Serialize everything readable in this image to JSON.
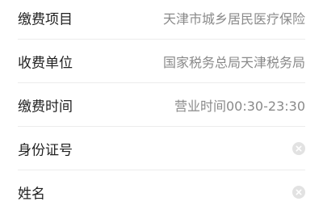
{
  "form": {
    "rows": [
      {
        "label": "缴费项目",
        "value": "天津市城乡居民医疗保险"
      },
      {
        "label": "收费单位",
        "value": "国家税务总局天津税务局"
      },
      {
        "label": "缴费时间",
        "value": "营业时间00:30-23:30"
      },
      {
        "label": "身份证号",
        "value": "",
        "placeholder": "",
        "clear_icon": "clear-icon"
      },
      {
        "label": "姓名",
        "value": "",
        "placeholder": "",
        "clear_icon": "clear-icon"
      }
    ]
  },
  "colors": {
    "label": "#222222",
    "value": "#8a8a8a",
    "divider": "#ececec",
    "clear_icon_bg": "#e2e2e2",
    "clear_icon_mark": "#ffffff"
  }
}
